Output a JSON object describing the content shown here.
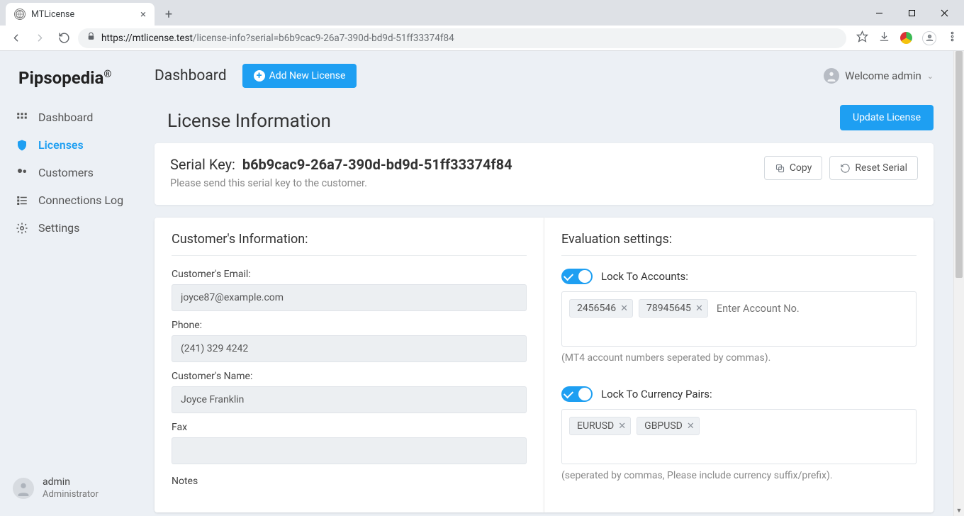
{
  "browser": {
    "tab_title": "MTLicense",
    "url_host": "https://mtlicense.test",
    "url_path": "/license-info?serial=b6b9cac9-26a7-390d-bd9d-51ff33374f84"
  },
  "brand": "Pipsopedia",
  "brand_suffix": "®",
  "sidebar": {
    "items": [
      {
        "label": "Dashboard",
        "icon": "grid"
      },
      {
        "label": "Licenses",
        "icon": "shield",
        "active": true
      },
      {
        "label": "Customers",
        "icon": "users"
      },
      {
        "label": "Connections Log",
        "icon": "list"
      },
      {
        "label": "Settings",
        "icon": "gear"
      }
    ],
    "footer_user": "admin",
    "footer_role": "Administrator"
  },
  "topbar": {
    "dashboard_label": "Dashboard",
    "add_license_label": "Add New License",
    "welcome_label": "Welcome admin"
  },
  "page_title": "License Information",
  "actions": {
    "update_license": "Update License",
    "copy": "Copy",
    "reset_serial": "Reset Serial"
  },
  "serial": {
    "label": "Serial Key:",
    "value": "b6b9cac9-26a7-390d-bd9d-51ff33374f84",
    "hint": "Please send this serial key to the customer."
  },
  "customer": {
    "section_title": "Customer's Information:",
    "email_label": "Customer's Email:",
    "email": "joyce87@example.com",
    "phone_label": "Phone:",
    "phone": "(241) 329 4242",
    "name_label": "Customer's Name:",
    "name": "Joyce Franklin",
    "fax_label": "Fax",
    "fax": "",
    "notes_label": "Notes"
  },
  "evaluation": {
    "section_title": "Evaluation settings:",
    "lock_accounts_label": "Lock To Accounts:",
    "accounts": [
      "2456546",
      "78945645"
    ],
    "account_placeholder": "Enter Account No.",
    "accounts_hint": "(MT4 account numbers seperated by commas).",
    "lock_pairs_label": "Lock To Currency Pairs:",
    "pairs": [
      "EURUSD",
      "GBPUSD"
    ],
    "pairs_hint": "(seperated by commas, Please include currency suffix/prefix)."
  }
}
